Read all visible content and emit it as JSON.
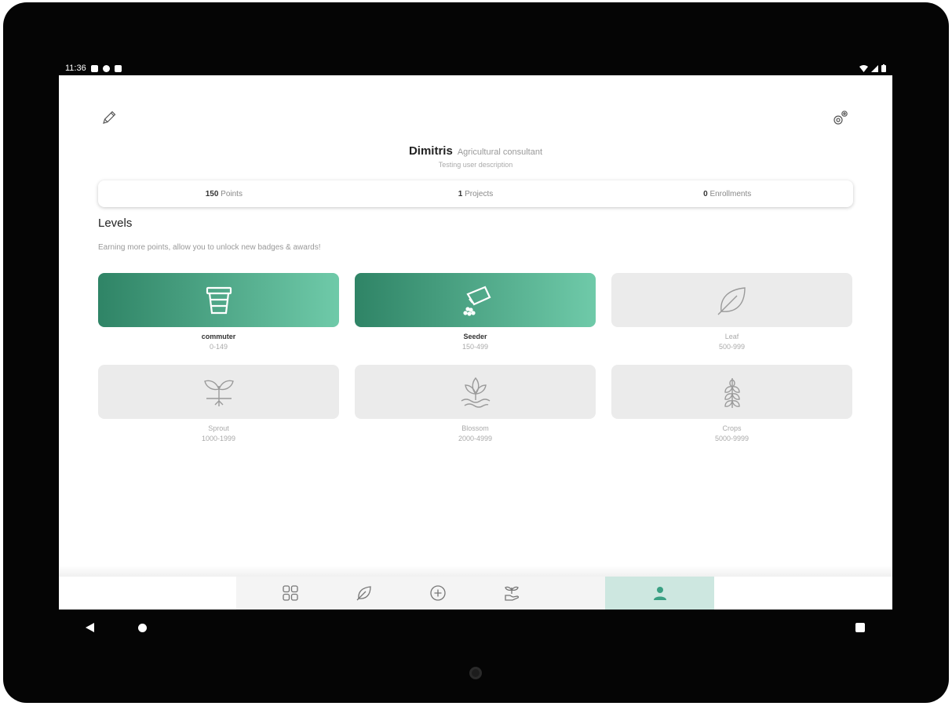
{
  "status_bar": {
    "time": "11:36"
  },
  "profile": {
    "name": "Dimitris",
    "role": "Agricultural consultant",
    "description": "Testing user description"
  },
  "stats": {
    "points_value": "150",
    "points_label": "Points",
    "projects_value": "1",
    "projects_label": "Projects",
    "enrollments_value": "0",
    "enrollments_label": "Enrollments"
  },
  "levels": {
    "title": "Levels",
    "subtitle": "Earning more points, allow you to unlock new badges & awards!",
    "items": [
      {
        "name": "commuter",
        "range": "0-149",
        "icon": "flower-pot-icon",
        "active": true
      },
      {
        "name": "Seeder",
        "range": "150-499",
        "icon": "seed-bag-icon",
        "active": true
      },
      {
        "name": "Leaf",
        "range": "500-999",
        "icon": "leaf-icon",
        "active": false
      },
      {
        "name": "Sprout",
        "range": "1000-1999",
        "icon": "sprout-icon",
        "active": false
      },
      {
        "name": "Blossom",
        "range": "2000-4999",
        "icon": "blossom-icon",
        "active": false
      },
      {
        "name": "Crops",
        "range": "5000-9999",
        "icon": "wheat-icon",
        "active": false
      }
    ]
  },
  "nav": {
    "items": [
      "grid-icon",
      "leaf-icon",
      "add-circle-icon",
      "plant-hand-icon",
      "person-icon"
    ],
    "active": "person-icon"
  },
  "colors": {
    "accent_dark": "#2f8466",
    "accent_light": "#6fcaa9",
    "nav_active": "#cde7e0",
    "nav_icon_active": "#3aa083",
    "tile_inactive": "#ebebeb"
  }
}
